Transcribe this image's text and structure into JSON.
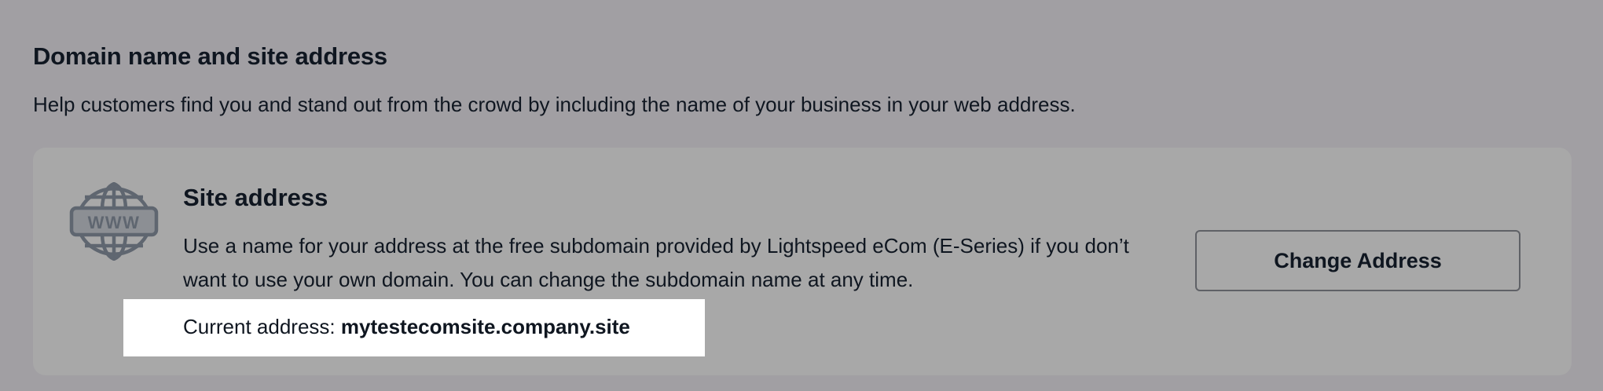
{
  "section": {
    "title": "Domain name and site address",
    "description": "Help customers find you and stand out from the crowd by including the name of your business in your web address."
  },
  "site_address_card": {
    "icon": "www-globe-icon",
    "icon_label": "WWW",
    "title": "Site address",
    "description": "Use a name for your address at the free subdomain provided by Lightspeed eCom (E-Series) if you don’t want to use your own domain. You can change the subdomain name at any time.",
    "current_address_label": "Current address: ",
    "current_address_value": "mytestecomsite.company.site",
    "change_button_label": "Change Address"
  },
  "colors": {
    "page_background": "#a19fa3",
    "card_background": "#a8a8a8",
    "text": "#0f1620",
    "icon": "#5f6670",
    "highlight": "#ffffff"
  }
}
